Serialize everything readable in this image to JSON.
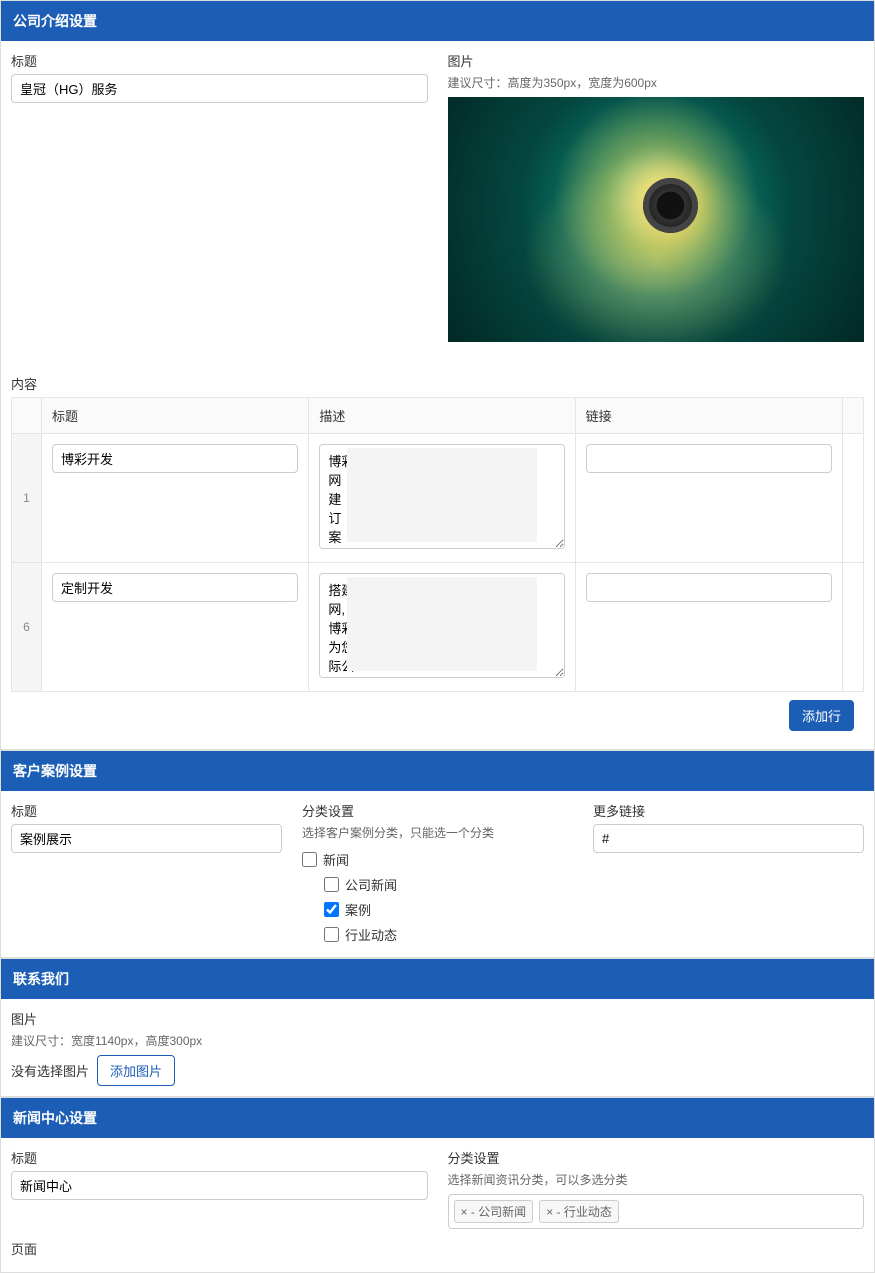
{
  "sections": {
    "company": {
      "heading": "公司介绍设置",
      "title_label": "标题",
      "title_value": "皇冠（HG）服务",
      "image_label": "图片",
      "image_help": "建议尺寸：高度为350px，宽度为600px",
      "content_label": "内容",
      "table": {
        "headers": {
          "title": "标题",
          "desc": "描述",
          "link": "链接"
        },
        "rows": [
          {
            "num": "1",
            "title": "博彩开发",
            "desc": "博彩\n网\n建\n订\n案\n计",
            "link": ""
          },
          {
            "num": "6",
            "title": "定制开发",
            "desc": "搭建\n网,\n博彩\n为您\n际公\n款自\n应商",
            "link": ""
          }
        ]
      },
      "add_row": "添加行"
    },
    "cases": {
      "heading": "客户案例设置",
      "title_label": "标题",
      "title_value": "案例展示",
      "category_label": "分类设置",
      "category_help": "选择客户案例分类，只能选一个分类",
      "more_link_label": "更多链接",
      "more_link_value": "#",
      "tree": {
        "root": "新闻",
        "children": [
          {
            "label": "公司新闻",
            "checked": false
          },
          {
            "label": "案例",
            "checked": true
          },
          {
            "label": "行业动态",
            "checked": false
          }
        ]
      }
    },
    "contact": {
      "heading": "联系我们",
      "image_label": "图片",
      "image_help": "建议尺寸：宽度1140px，高度300px",
      "no_file": "没有选择图片",
      "add_image": "添加图片"
    },
    "news": {
      "heading": "新闻中心设置",
      "title_label": "标题",
      "title_value": "新闻中心",
      "category_label": "分类设置",
      "category_help": "选择新闻资讯分类，可以多选分类",
      "tags": [
        "× - 公司新闻",
        "× - 行业动态"
      ]
    },
    "page": {
      "label": "页面"
    }
  }
}
